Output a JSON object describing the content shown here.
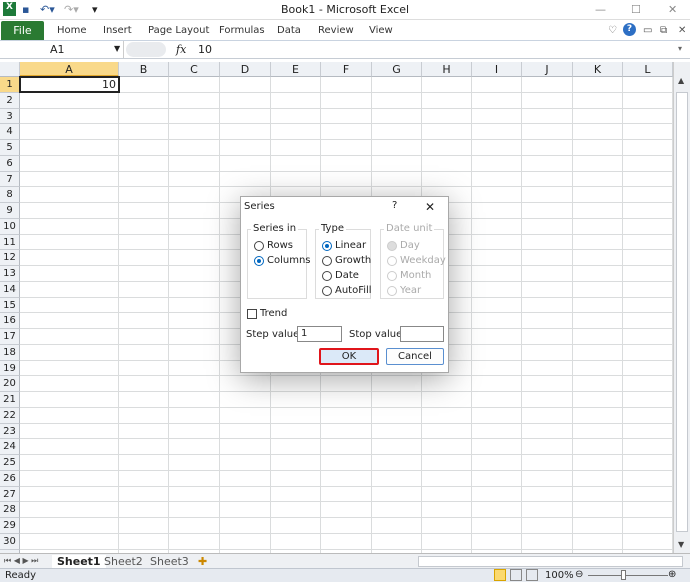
{
  "window": {
    "title": "Book1  -  Microsoft Excel",
    "min": "—",
    "max": "☐",
    "close": "✕"
  },
  "ribbon": {
    "file": "File",
    "tabs": [
      "Home",
      "Insert",
      "Page Layout",
      "Formulas",
      "Data",
      "Review",
      "View"
    ]
  },
  "formula_bar": {
    "name_box": "A1",
    "fx": "fx",
    "value": "10"
  },
  "columns": [
    "A",
    "B",
    "C",
    "D",
    "E",
    "F",
    "G",
    "H",
    "I",
    "J",
    "K",
    "L"
  ],
  "rows": 30,
  "cells": {
    "A1": "10"
  },
  "sheets": [
    "Sheet1",
    "Sheet2",
    "Sheet3"
  ],
  "status": {
    "ready": "Ready",
    "zoom": "100%"
  },
  "dialog": {
    "title": "Series",
    "help": "?",
    "close": "✕",
    "series_in": {
      "label": "Series in",
      "options": [
        "Rows",
        "Columns"
      ],
      "selected": 1
    },
    "type": {
      "label": "Type",
      "options": [
        "Linear",
        "Growth",
        "Date",
        "AutoFill"
      ],
      "selected": 0
    },
    "date_unit": {
      "label": "Date unit",
      "options": [
        "Day",
        "Weekday",
        "Month",
        "Year"
      ]
    },
    "trend": {
      "label": "Trend",
      "checked": false
    },
    "step": {
      "label": "Step value:",
      "value": "1"
    },
    "stop": {
      "label": "Stop value:",
      "value": ""
    },
    "ok": "OK",
    "cancel": "Cancel"
  }
}
